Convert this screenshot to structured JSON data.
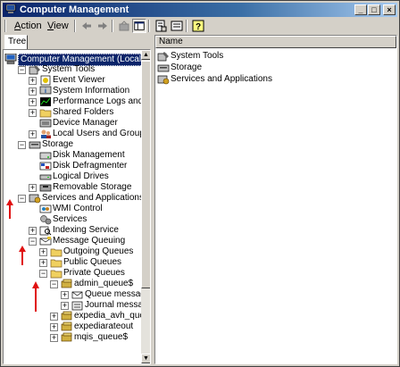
{
  "window": {
    "title": "Computer Management"
  },
  "menu": {
    "action": "Action",
    "view": "View"
  },
  "tabs": {
    "tree": "Tree"
  },
  "tree": [
    {
      "label": "Computer Management (Local)",
      "expander": "",
      "icon": "computer-icon",
      "selected": true
    },
    {
      "label": "System Tools",
      "expander": "−",
      "icon": "system-tools-icon"
    },
    {
      "label": "Event Viewer",
      "expander": "+",
      "icon": "event-viewer-icon"
    },
    {
      "label": "System Information",
      "expander": "+",
      "icon": "system-info-icon"
    },
    {
      "label": "Performance Logs and Alerts",
      "expander": "+",
      "icon": "performance-icon"
    },
    {
      "label": "Shared Folders",
      "expander": "+",
      "icon": "folder-icon"
    },
    {
      "label": "Device Manager",
      "expander": "",
      "icon": "device-manager-icon"
    },
    {
      "label": "Local Users and Groups",
      "expander": "+",
      "icon": "users-icon"
    },
    {
      "label": "Storage",
      "expander": "−",
      "icon": "storage-icon"
    },
    {
      "label": "Disk Management",
      "expander": "",
      "icon": "disk-icon"
    },
    {
      "label": "Disk Defragmenter",
      "expander": "",
      "icon": "defrag-icon"
    },
    {
      "label": "Logical Drives",
      "expander": "",
      "icon": "drive-icon"
    },
    {
      "label": "Removable Storage",
      "expander": "+",
      "icon": "removable-icon"
    },
    {
      "label": "Services and Applications",
      "expander": "−",
      "icon": "services-apps-icon"
    },
    {
      "label": "WMI Control",
      "expander": "",
      "icon": "wmi-icon"
    },
    {
      "label": "Services",
      "expander": "",
      "icon": "services-icon"
    },
    {
      "label": "Indexing Service",
      "expander": "+",
      "icon": "indexing-icon"
    },
    {
      "label": "Message Queuing",
      "expander": "−",
      "icon": "message-queuing-icon"
    },
    {
      "label": "Outgoing Queues",
      "expander": "+",
      "icon": "folder-icon"
    },
    {
      "label": "Public Queues",
      "expander": "+",
      "icon": "folder-icon"
    },
    {
      "label": "Private Queues",
      "expander": "−",
      "icon": "folder-icon"
    },
    {
      "label": "admin_queue$",
      "expander": "−",
      "icon": "queue-icon"
    },
    {
      "label": "Queue messages",
      "expander": "+",
      "icon": "queue-messages-icon"
    },
    {
      "label": "Journal messages",
      "expander": "+",
      "icon": "journal-messages-icon"
    },
    {
      "label": "expedia_avh_queue",
      "expander": "+",
      "icon": "queue-icon"
    },
    {
      "label": "expediarateout",
      "expander": "+",
      "icon": "queue-icon"
    },
    {
      "label": "mqis_queue$",
      "expander": "+",
      "icon": "queue-icon"
    }
  ],
  "list": {
    "column": "Name",
    "items": [
      {
        "label": "System Tools",
        "icon": "system-tools-icon"
      },
      {
        "label": "Storage",
        "icon": "storage-icon"
      },
      {
        "label": "Services and Applications",
        "icon": "services-apps-icon"
      }
    ]
  },
  "colors": {
    "annotation_arrow": "#e01010",
    "selection": "#0a246a",
    "titlebar": "#0a246a"
  }
}
